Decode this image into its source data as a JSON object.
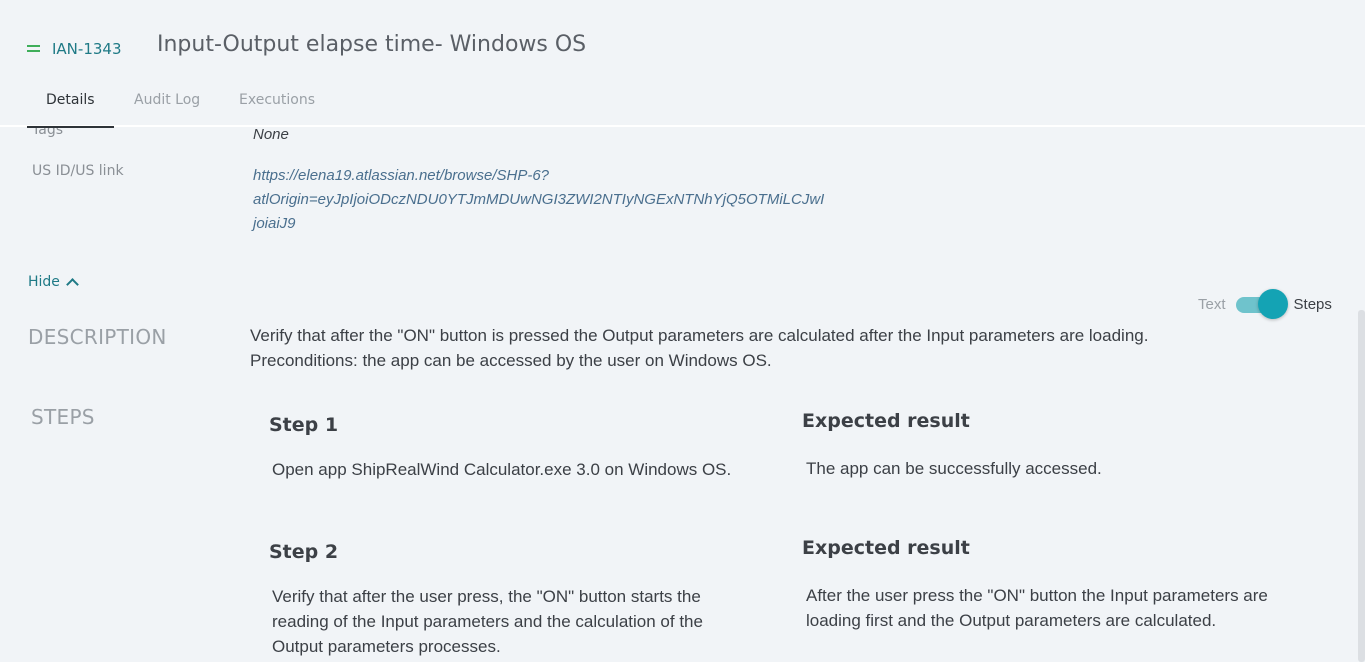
{
  "header": {
    "issue_key": "IAN-1343",
    "title": "Input-Output elapse time- Windows OS",
    "tabs": [
      {
        "label": "Details",
        "active": true
      },
      {
        "label": "Audit Log",
        "active": false
      },
      {
        "label": "Executions",
        "active": false
      }
    ]
  },
  "fields": {
    "tags_label": "Tags",
    "tags_value": "None",
    "us_label": "US ID/US link",
    "us_link_lines": [
      "https://elena19.atlassian.net/browse/SHP-6?",
      "atlOrigin=eyJpIjoiODczNDU0YTJmMDUwNGI3ZWI2NTIyNGExNTNhYjQ5OTMiLCJwI",
      "joiaiJ9"
    ]
  },
  "hide_label": "Hide",
  "description": {
    "title": "DESCRIPTION",
    "lines": [
      "Verify that after the \"ON\" button is pressed the Output parameters are calculated after the Input parameters are loading.",
      "Preconditions: the app can be accessed by the user on Windows OS."
    ]
  },
  "steps": {
    "title": "STEPS",
    "toggle": {
      "off_label": "Text",
      "on_label": "Steps",
      "state": "Steps"
    },
    "items": [
      {
        "heading": "Step 1",
        "text": "Open app ShipRealWind Calculator.exe 3.0 on Windows OS.",
        "expected_heading": "Expected result",
        "expected": "The app can be successfully accessed."
      },
      {
        "heading": "Step 2",
        "text": "Verify that after the user press, the \"ON\" button starts the reading of the Input parameters and the calculation of the Output parameters processes.",
        "expected_heading": "Expected result",
        "expected": "After the user press the \"ON\" button the Input parameters are loading first and the Output parameters are calculated."
      }
    ]
  },
  "colors": {
    "accent": "#1f7a86",
    "priority": "#3fae5a",
    "toggle": "#14a3b4",
    "background": "#f1f4f7"
  }
}
